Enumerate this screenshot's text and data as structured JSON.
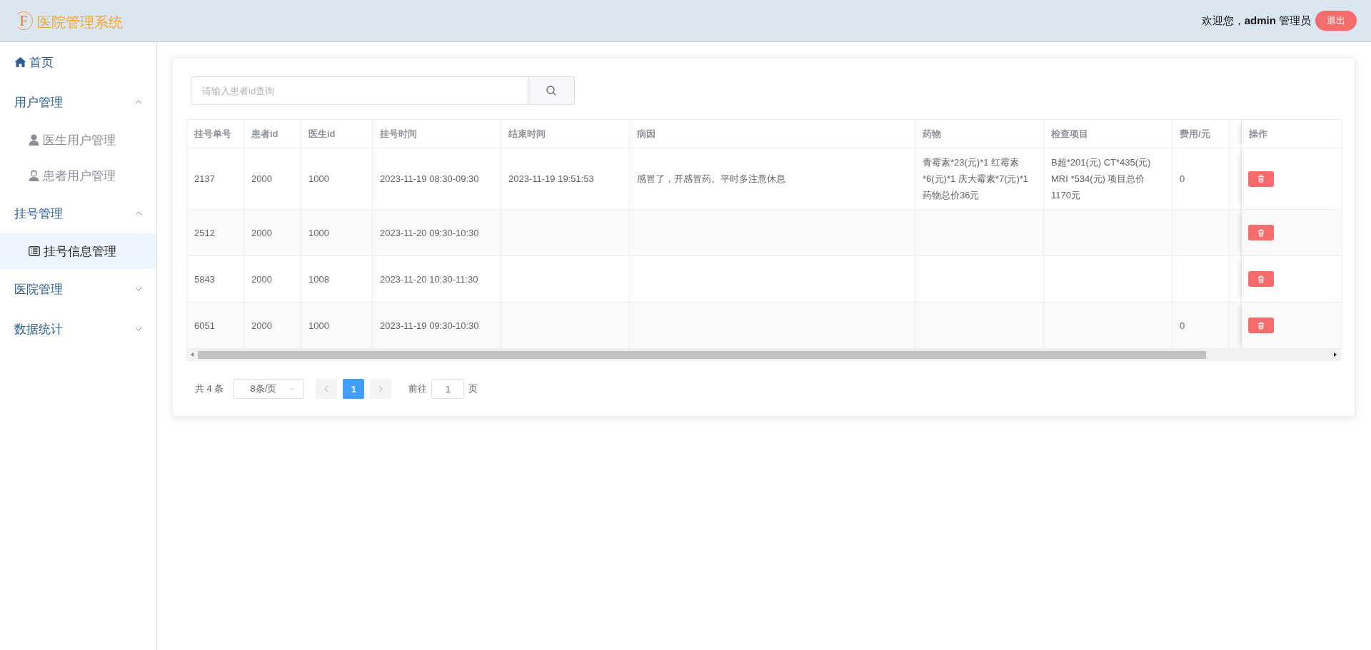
{
  "header": {
    "logo_letter": "F",
    "title": "医院管理系统",
    "welcome": "欢迎您，**admin** 管理员",
    "logout": "退出"
  },
  "sidebar": {
    "items": [
      {
        "kind": "home",
        "label": "首页",
        "selected": false
      },
      {
        "kind": "group",
        "label": "用户管理",
        "expanded": true,
        "children": [
          {
            "label": "医生用户管理",
            "selected": false
          },
          {
            "label": "患者用户管理",
            "selected": false
          }
        ]
      },
      {
        "kind": "group",
        "label": "挂号管理",
        "expanded": true,
        "children": [
          {
            "label": "挂号信息管理",
            "selected": true
          }
        ]
      },
      {
        "kind": "group",
        "label": "医院管理",
        "expanded": false
      },
      {
        "kind": "group",
        "label": "数据统计",
        "expanded": false
      }
    ]
  },
  "search": {
    "placeholder": "请输入患者id查询"
  },
  "table": {
    "columns": [
      {
        "label": "挂号单号",
        "kind": "text"
      },
      {
        "label": "患者id",
        "kind": "text"
      },
      {
        "label": "医生id",
        "kind": "text"
      },
      {
        "label": "挂号时间",
        "kind": "text"
      },
      {
        "label": "结束时间",
        "kind": "text"
      },
      {
        "label": "病因",
        "kind": "text"
      },
      {
        "label": "药物",
        "kind": "text"
      },
      {
        "label": "检查项目",
        "kind": "text"
      },
      {
        "label": "费用/元",
        "kind": "text"
      },
      {
        "kind": "cut"
      },
      {
        "label": "操作",
        "kind": "action"
      }
    ],
    "rows": [
      {
        "cells": [
          "2137",
          "2000",
          "1000",
          "2023-11-19 08:30-09:30",
          "2023-11-19 19:51:53",
          "感冒了，开感冒药。平时多注意休息",
          "青霉素*23(元)*1 红霉素*6(元)*1 庆大霉素*7(元)*1 药物总价36元",
          "B超*201(元) CT*435(元) MRI *534(元) 项目总价1170元",
          "0"
        ]
      },
      {
        "cells": [
          "2512",
          "2000",
          "1000",
          "2023-11-20 09:30-10:30",
          "",
          "",
          "",
          "",
          ""
        ]
      },
      {
        "cells": [
          "5843",
          "2000",
          "1008",
          "2023-11-20 10:30-11:30",
          "",
          "",
          "",
          "",
          ""
        ]
      },
      {
        "cells": [
          "6051",
          "2000",
          "1000",
          "2023-11-19 09:30-10:30",
          "",
          "",
          "",
          "",
          "0"
        ]
      }
    ]
  },
  "pagination": {
    "total": "共 4 条",
    "page_size": "8条/页",
    "pages": [
      {
        "label": "1",
        "selected": true
      }
    ],
    "goto_label": "前往",
    "goto_value": "1",
    "goto_suffix": "页"
  }
}
